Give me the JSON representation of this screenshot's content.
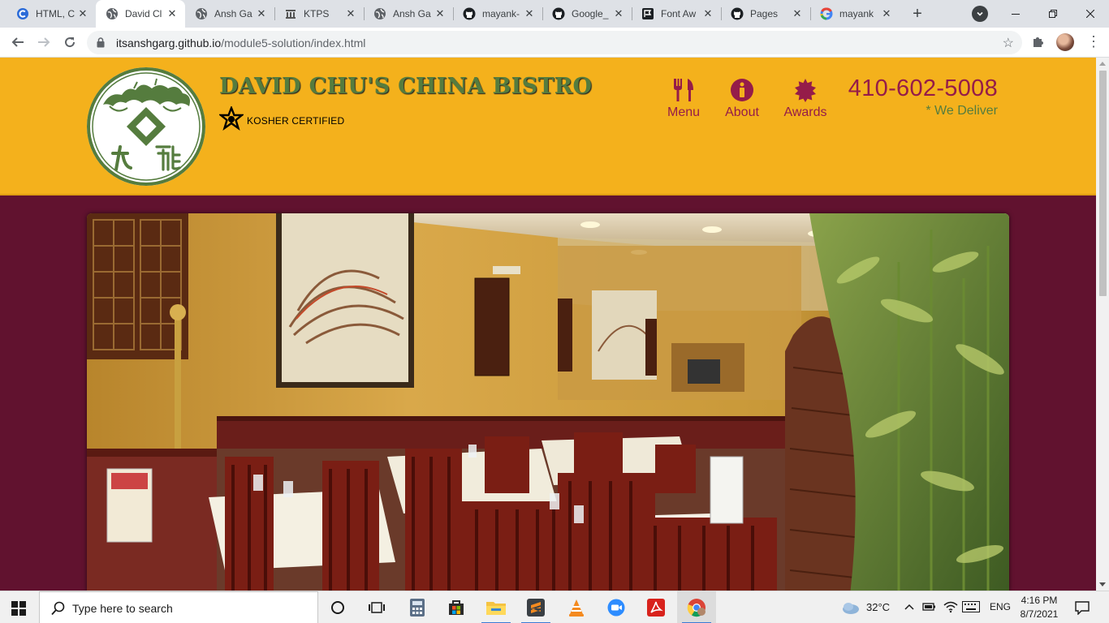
{
  "browser": {
    "tabs": [
      {
        "title": "HTML, C",
        "favicon": "c-icon"
      },
      {
        "title": "David Cl",
        "favicon": "globe-icon",
        "active": true
      },
      {
        "title": "Ansh Ga",
        "favicon": "globe-icon"
      },
      {
        "title": "KTPS",
        "favicon": "ktps-icon"
      },
      {
        "title": "Ansh Ga",
        "favicon": "globe-icon"
      },
      {
        "title": "mayank-",
        "favicon": "github-icon"
      },
      {
        "title": "Google_",
        "favicon": "github-icon"
      },
      {
        "title": "Font Aw",
        "favicon": "flag-icon"
      },
      {
        "title": "Pages",
        "favicon": "github-icon"
      },
      {
        "title": "mayank",
        "favicon": "google-icon"
      }
    ],
    "url_host": "itsanshgarg.github.io",
    "url_path": "/module5-solution/index.html"
  },
  "site": {
    "brand_name": "DAVID CHU'S CHINA BISTRO",
    "kosher_label": "KOSHER CERTIFIED",
    "nav": [
      {
        "label": "Menu",
        "icon": "cutlery-icon"
      },
      {
        "label": "About",
        "icon": "info-icon"
      },
      {
        "label": "Awards",
        "icon": "certificate-icon"
      }
    ],
    "phone": "410-602-5008",
    "deliver": "* We Deliver",
    "colors": {
      "header_bg": "#f4b11c",
      "body_bg": "#61122f",
      "accent": "#951c49",
      "brand_green": "#557c3e"
    }
  },
  "taskbar": {
    "search_placeholder": "Type here to search",
    "weather": "32°C",
    "language": "ENG",
    "time": "4:16 PM",
    "date": "8/7/2021"
  }
}
